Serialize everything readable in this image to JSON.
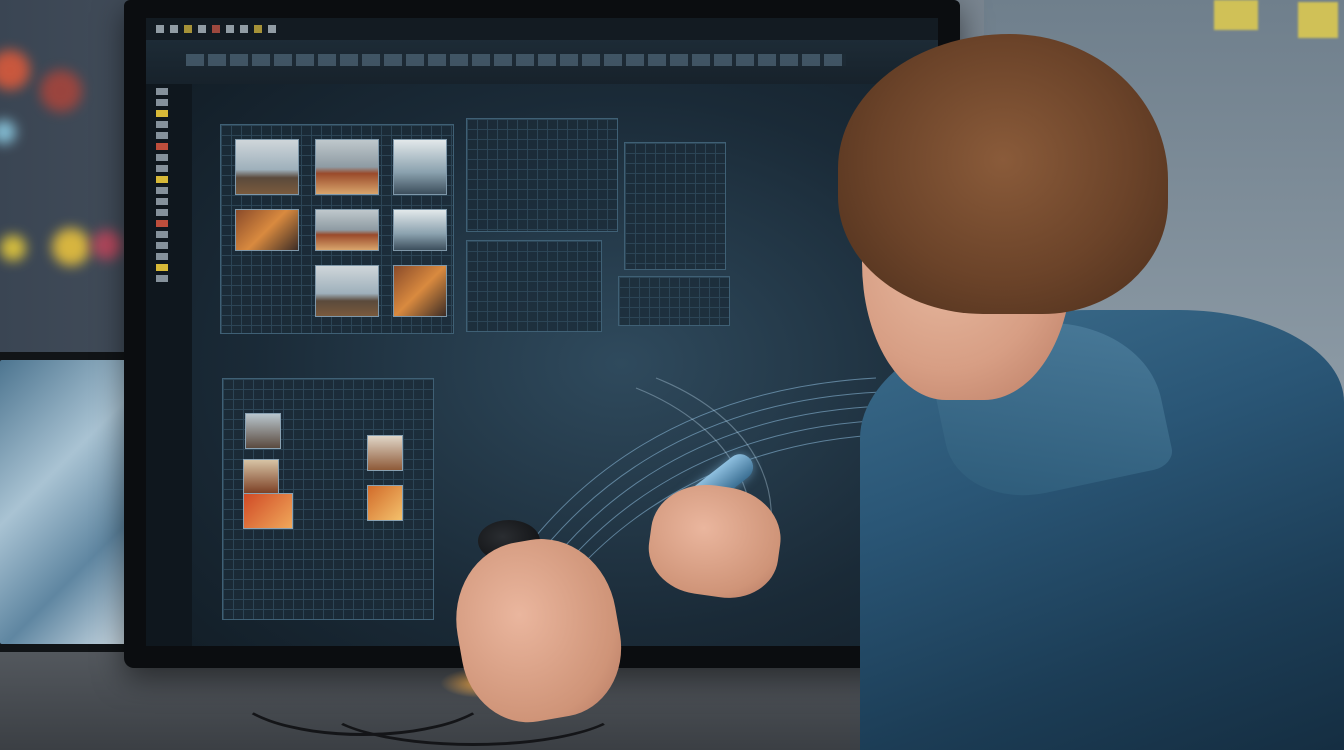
{
  "scene": {
    "description_tags": [
      "office",
      "monitor",
      "editing-software",
      "person",
      "stylus"
    ]
  },
  "monitor": {
    "app_ui": {
      "menu_items": [
        "",
        "",
        "",
        "",
        "",
        "",
        "",
        "",
        ""
      ],
      "toolbar_label": "",
      "status_text": ""
    }
  },
  "colors": {
    "accent_yellow": "#e3c23a",
    "accent_red": "#d0543f",
    "ui_blue": "#2f4a5d",
    "jacket_blue": "#2a5676"
  }
}
